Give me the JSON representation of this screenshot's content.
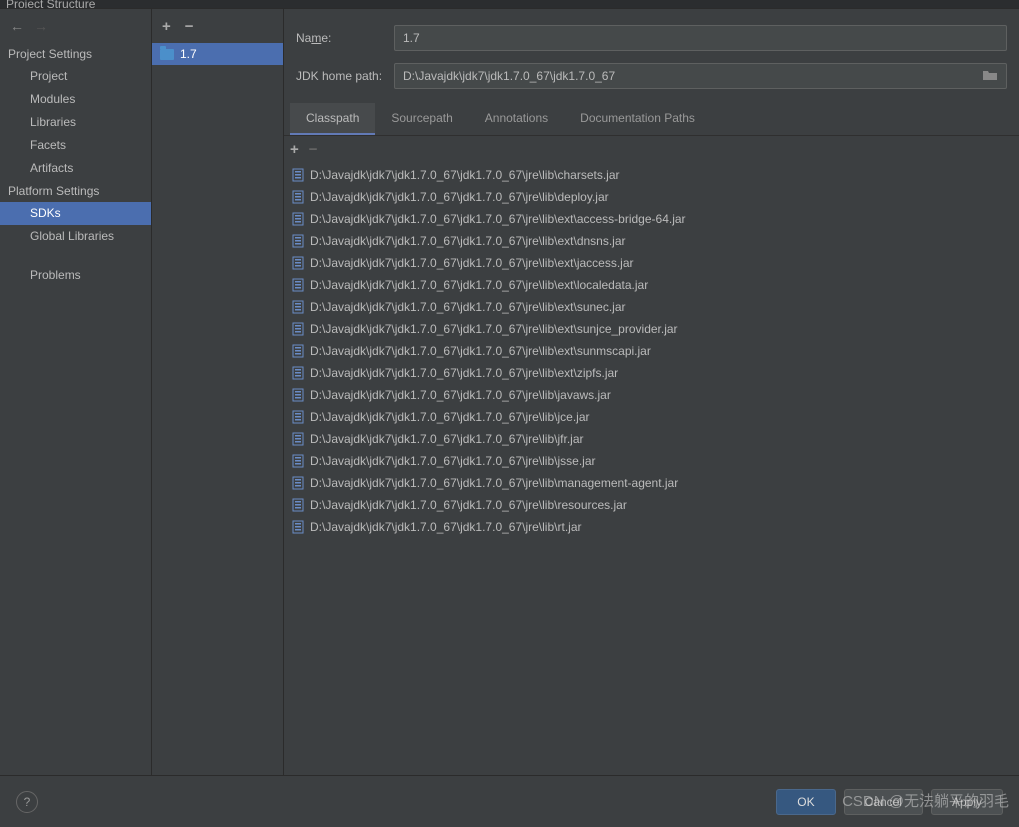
{
  "titlebar": "Project Structure",
  "sidebar": {
    "project_settings_heading": "Project Settings",
    "project_items": [
      "Project",
      "Modules",
      "Libraries",
      "Facets",
      "Artifacts"
    ],
    "platform_settings_heading": "Platform Settings",
    "platform_items": [
      "SDKs",
      "Global Libraries"
    ],
    "problems": "Problems",
    "selected": "SDKs"
  },
  "sdk_list": {
    "items": [
      {
        "name": "1.7"
      }
    ],
    "selected": "1.7"
  },
  "form": {
    "name_label": "Name:",
    "name_value": "1.7",
    "path_label": "JDK home path:",
    "path_value": "D:\\Javajdk\\jdk7\\jdk1.7.0_67\\jdk1.7.0_67"
  },
  "tabs": {
    "items": [
      "Classpath",
      "Sourcepath",
      "Annotations",
      "Documentation Paths"
    ],
    "active": "Classpath"
  },
  "classpath": [
    "D:\\Javajdk\\jdk7\\jdk1.7.0_67\\jdk1.7.0_67\\jre\\lib\\charsets.jar",
    "D:\\Javajdk\\jdk7\\jdk1.7.0_67\\jdk1.7.0_67\\jre\\lib\\deploy.jar",
    "D:\\Javajdk\\jdk7\\jdk1.7.0_67\\jdk1.7.0_67\\jre\\lib\\ext\\access-bridge-64.jar",
    "D:\\Javajdk\\jdk7\\jdk1.7.0_67\\jdk1.7.0_67\\jre\\lib\\ext\\dnsns.jar",
    "D:\\Javajdk\\jdk7\\jdk1.7.0_67\\jdk1.7.0_67\\jre\\lib\\ext\\jaccess.jar",
    "D:\\Javajdk\\jdk7\\jdk1.7.0_67\\jdk1.7.0_67\\jre\\lib\\ext\\localedata.jar",
    "D:\\Javajdk\\jdk7\\jdk1.7.0_67\\jdk1.7.0_67\\jre\\lib\\ext\\sunec.jar",
    "D:\\Javajdk\\jdk7\\jdk1.7.0_67\\jdk1.7.0_67\\jre\\lib\\ext\\sunjce_provider.jar",
    "D:\\Javajdk\\jdk7\\jdk1.7.0_67\\jdk1.7.0_67\\jre\\lib\\ext\\sunmscapi.jar",
    "D:\\Javajdk\\jdk7\\jdk1.7.0_67\\jdk1.7.0_67\\jre\\lib\\ext\\zipfs.jar",
    "D:\\Javajdk\\jdk7\\jdk1.7.0_67\\jdk1.7.0_67\\jre\\lib\\javaws.jar",
    "D:\\Javajdk\\jdk7\\jdk1.7.0_67\\jdk1.7.0_67\\jre\\lib\\jce.jar",
    "D:\\Javajdk\\jdk7\\jdk1.7.0_67\\jdk1.7.0_67\\jre\\lib\\jfr.jar",
    "D:\\Javajdk\\jdk7\\jdk1.7.0_67\\jdk1.7.0_67\\jre\\lib\\jsse.jar",
    "D:\\Javajdk\\jdk7\\jdk1.7.0_67\\jdk1.7.0_67\\jre\\lib\\management-agent.jar",
    "D:\\Javajdk\\jdk7\\jdk1.7.0_67\\jdk1.7.0_67\\jre\\lib\\resources.jar",
    "D:\\Javajdk\\jdk7\\jdk1.7.0_67\\jdk1.7.0_67\\jre\\lib\\rt.jar"
  ],
  "footer": {
    "ok": "OK",
    "cancel": "Cancel",
    "apply": "Apply"
  },
  "watermark": "CSDN @无法躺平的羽毛"
}
